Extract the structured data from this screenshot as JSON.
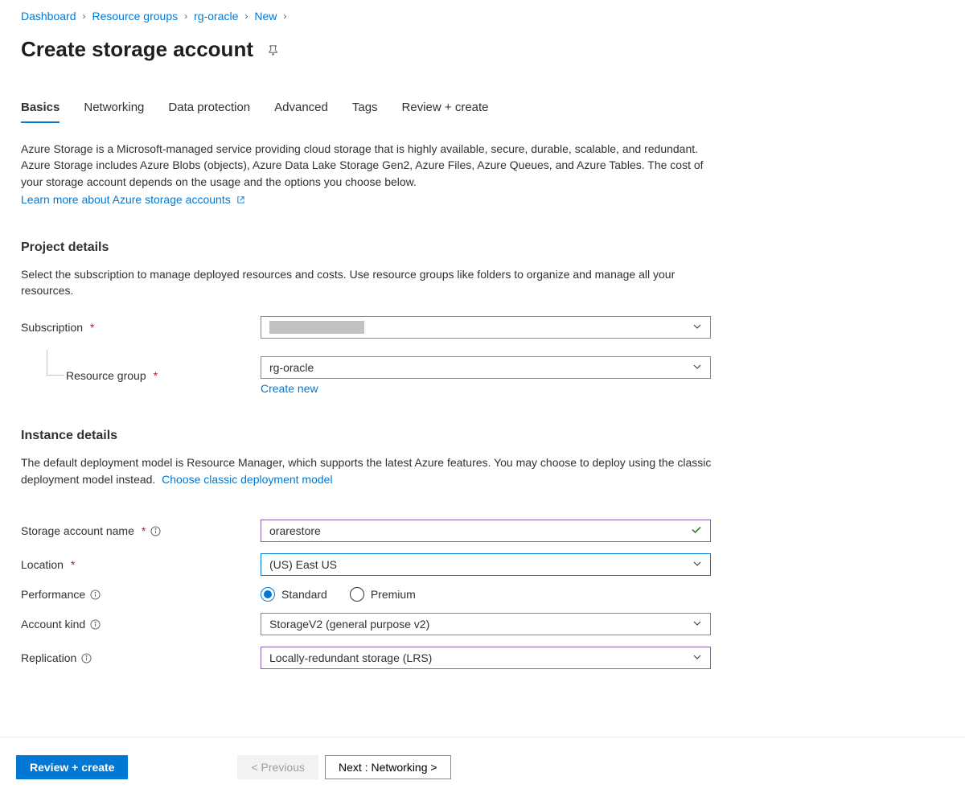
{
  "breadcrumb": {
    "items": [
      "Dashboard",
      "Resource groups",
      "rg-oracle",
      "New"
    ]
  },
  "page_title": "Create storage account",
  "tabs": {
    "items": [
      {
        "label": "Basics",
        "active": true
      },
      {
        "label": "Networking",
        "active": false
      },
      {
        "label": "Data protection",
        "active": false
      },
      {
        "label": "Advanced",
        "active": false
      },
      {
        "label": "Tags",
        "active": false
      },
      {
        "label": "Review + create",
        "active": false
      }
    ]
  },
  "intro": {
    "text": "Azure Storage is a Microsoft-managed service providing cloud storage that is highly available, secure, durable, scalable, and redundant. Azure Storage includes Azure Blobs (objects), Azure Data Lake Storage Gen2, Azure Files, Azure Queues, and Azure Tables. The cost of your storage account depends on the usage and the options you choose below.",
    "learn_link": "Learn more about Azure storage accounts"
  },
  "project_details": {
    "heading": "Project details",
    "description": "Select the subscription to manage deployed resources and costs. Use resource groups like folders to organize and manage all your resources.",
    "subscription_label": "Subscription",
    "subscription_value": "",
    "resource_group_label": "Resource group",
    "resource_group_value": "rg-oracle",
    "create_new": "Create new"
  },
  "instance_details": {
    "heading": "Instance details",
    "description": "The default deployment model is Resource Manager, which supports the latest Azure features. You may choose to deploy using the classic deployment model instead.",
    "classic_link": "Choose classic deployment model",
    "storage_account_name_label": "Storage account name",
    "storage_account_name_value": "orarestore",
    "location_label": "Location",
    "location_value": "(US) East US",
    "performance_label": "Performance",
    "performance_options": {
      "standard": "Standard",
      "premium": "Premium"
    },
    "performance_selected": "standard",
    "account_kind_label": "Account kind",
    "account_kind_value": "StorageV2 (general purpose v2)",
    "replication_label": "Replication",
    "replication_value": "Locally-redundant storage (LRS)"
  },
  "footer": {
    "review": "Review + create",
    "previous": "< Previous",
    "next": "Next : Networking >"
  }
}
